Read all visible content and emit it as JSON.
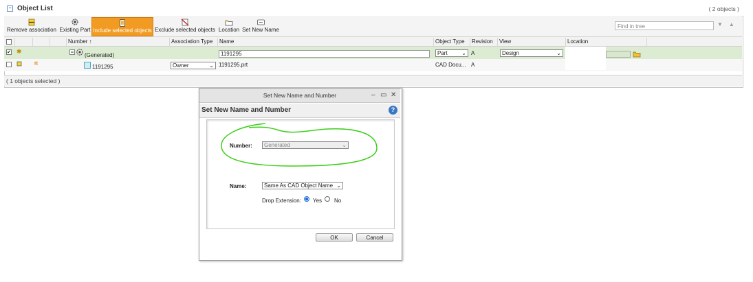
{
  "panel": {
    "title": "Object List",
    "count": "( 2 objects )"
  },
  "toolbar": {
    "remove_association": "Remove association",
    "existing_part": "Existing Part",
    "include_selected": "Include selected objects",
    "exclude_selected": "Exclude selected objects",
    "location": "Location",
    "set_new_name": "Set New Name",
    "find_placeholder": "Find in tree",
    "find_arrows": "▼▲"
  },
  "table": {
    "headers": {
      "number": "Number ↑",
      "association_type": "Association Type",
      "name": "Name",
      "object_type": "Object Type",
      "revision": "Revision",
      "view": "View",
      "location": "Location"
    },
    "rows": [
      {
        "checked": "✔",
        "number": "(Generated)",
        "name": "1191295",
        "object_type": "Part",
        "revision": "A",
        "view": "Design"
      },
      {
        "checked": "",
        "number": "1191295",
        "association_type": "Owner",
        "name": "1191295.prt",
        "object_type": "CAD Docu...",
        "revision": "A"
      }
    ],
    "selected_status": "( 1 objects selected )"
  },
  "dialog": {
    "window_title": "Set New Name and Number",
    "header": "Set New Name and Number",
    "number_label": "Number:",
    "number_value": "Generated",
    "name_label": "Name:",
    "name_value": "Same As CAD Object Name",
    "drop_extension_label": "Drop Extension:",
    "yes_label": "Yes",
    "no_label": "No",
    "ok_label": "OK",
    "cancel_label": "Cancel",
    "highlight_color": "#3ccf1a"
  }
}
